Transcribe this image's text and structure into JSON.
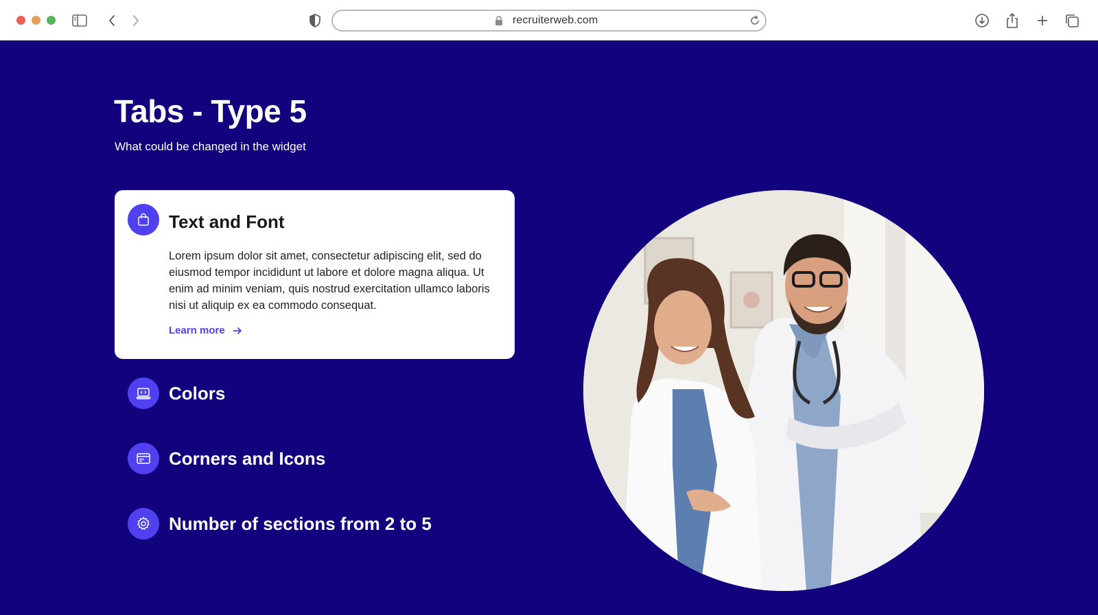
{
  "browser": {
    "url": "recruiterweb.com",
    "icons": {
      "sidebar": "sidebar-icon",
      "back": "chevron-left-icon",
      "forward": "chevron-right-icon",
      "privacy": "shield-icon",
      "lock": "lock-icon",
      "reload": "reload-icon",
      "download": "download-icon",
      "share": "share-icon",
      "new_tab": "plus-icon",
      "tabs": "tabs-overview-icon"
    }
  },
  "page": {
    "title": "Tabs - Type 5",
    "subtitle": "What could be changed in the widget",
    "background_color": "#12027d",
    "accent_color": "#5041f0"
  },
  "tabs": {
    "active": {
      "title": "Text and Font",
      "icon": "shopping-bag-icon",
      "body": "Lorem ipsum dolor sit amet, consectetur adipiscing elit, sed do eiusmod tempor incididunt ut labore et dolore magna aliqua. Ut enim ad minim veniam, quis nostrud exercitation ullamco laboris nisi ut aliquip ex ea commodo consequat.",
      "link_label": "Learn more"
    },
    "items": [
      {
        "label": "Colors",
        "icon": "laptop-code-icon"
      },
      {
        "label": "Corners and Icons",
        "icon": "browser-window-icon"
      },
      {
        "label": "Number of sections from 2 to 5",
        "icon": "gear-icon"
      }
    ]
  },
  "image": {
    "subject": "two smiling doctors in white coats"
  }
}
